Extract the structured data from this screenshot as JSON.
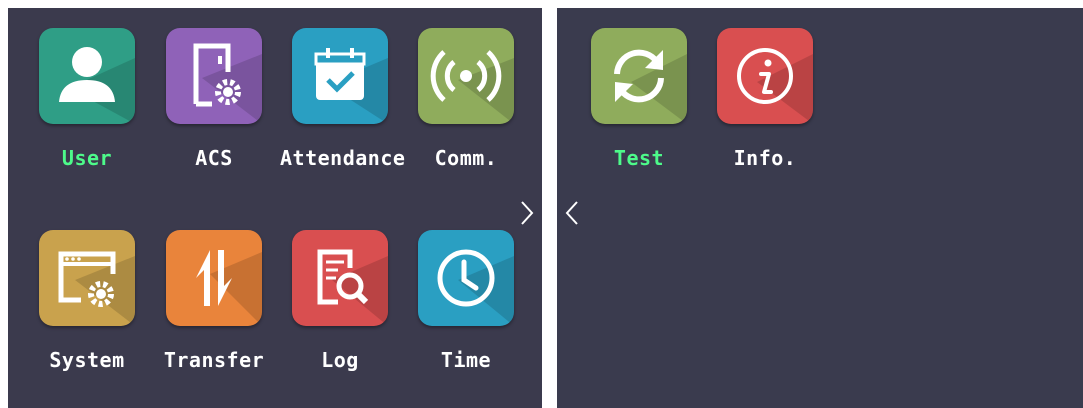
{
  "colors": {
    "active_label": "#4dfa8a",
    "label": "#ffffff",
    "screen_bg": "#3b3a4d"
  },
  "left_page": {
    "tiles": [
      {
        "label": "User",
        "icon": "user-icon",
        "color": "#2f9e86",
        "active": true
      },
      {
        "label": "ACS",
        "icon": "door-settings-icon",
        "color": "#8f62b8",
        "active": false
      },
      {
        "label": "Attendance",
        "icon": "calendar-check-icon",
        "color": "#2a9fc2",
        "active": false
      },
      {
        "label": "Comm.",
        "icon": "wireless-icon",
        "color": "#8fac5c",
        "active": false
      },
      {
        "label": "System",
        "icon": "window-settings-icon",
        "color": "#c9a24d",
        "active": false
      },
      {
        "label": "Transfer",
        "icon": "transfer-icon",
        "color": "#e9843b",
        "active": false
      },
      {
        "label": "Log",
        "icon": "log-search-icon",
        "color": "#d94f50",
        "active": false
      },
      {
        "label": "Time",
        "icon": "clock-icon",
        "color": "#2a9fc2",
        "active": false
      }
    ],
    "next_arrow": "chevron-right-icon"
  },
  "right_page": {
    "tiles": [
      {
        "label": "Test",
        "icon": "refresh-icon",
        "color": "#8fac5c",
        "active": true
      },
      {
        "label": "Info.",
        "icon": "info-icon",
        "color": "#d94f50",
        "active": false
      }
    ],
    "prev_arrow": "chevron-left-icon"
  }
}
